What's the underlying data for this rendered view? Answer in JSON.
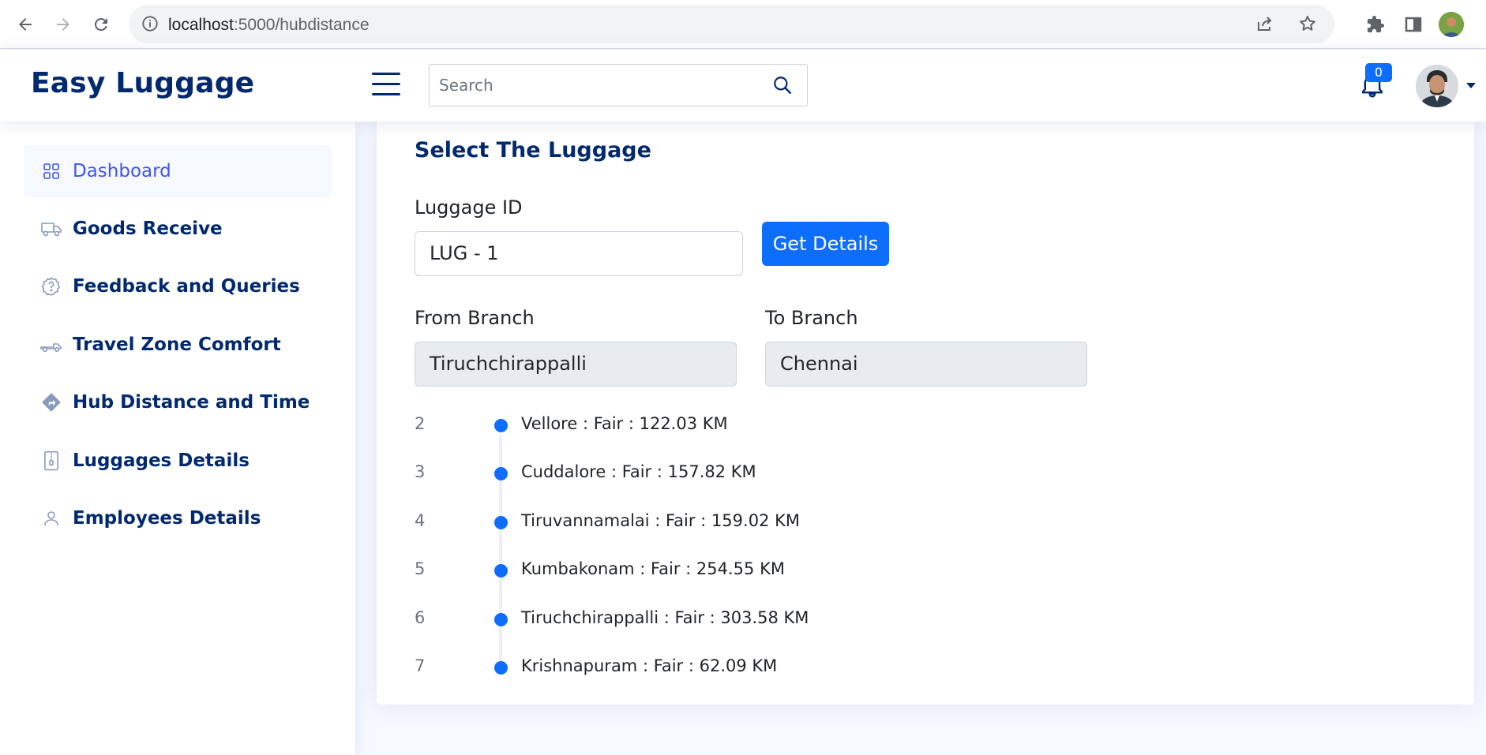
{
  "browser": {
    "url_host": "localhost",
    "url_path": ":5000/hubdistance"
  },
  "header": {
    "logo": "Easy Luggage",
    "search_placeholder": "Search",
    "notification_count": "0"
  },
  "sidebar": {
    "items": [
      {
        "label": "Dashboard",
        "icon": "grid-icon",
        "active": true
      },
      {
        "label": "Goods Receive",
        "icon": "truck-icon"
      },
      {
        "label": "Feedback and Queries",
        "icon": "question-icon"
      },
      {
        "label": "Travel Zone Comfort",
        "icon": "truck-flatbed-icon"
      },
      {
        "label": "Hub Distance and Time",
        "icon": "sign-turn-icon"
      },
      {
        "label": "Luggages Details",
        "icon": "file-zip-icon"
      },
      {
        "label": "Employees Details",
        "icon": "person-icon"
      }
    ]
  },
  "main": {
    "title": "Select The Luggage",
    "luggage_id_label": "Luggage ID",
    "luggage_id_value": "LUG - 1",
    "get_details_label": "Get Details",
    "from_branch_label": "From Branch",
    "from_branch_value": "Tiruchchirappalli",
    "to_branch_label": "To Branch",
    "to_branch_value": "Chennai",
    "timeline": [
      {
        "num": "2",
        "text": "Vellore : Fair : 122.03 KM"
      },
      {
        "num": "3",
        "text": "Cuddalore : Fair : 157.82 KM"
      },
      {
        "num": "4",
        "text": "Tiruvannamalai : Fair : 159.02 KM"
      },
      {
        "num": "5",
        "text": "Kumbakonam : Fair : 254.55 KM"
      },
      {
        "num": "6",
        "text": "Tiruchchirappalli : Fair : 303.58 KM"
      },
      {
        "num": "7",
        "text": "Krishnapuram : Fair : 62.09 KM"
      }
    ]
  },
  "colors": {
    "primary": "#0d6efd",
    "navy": "#012970",
    "active": "#4154f1"
  }
}
